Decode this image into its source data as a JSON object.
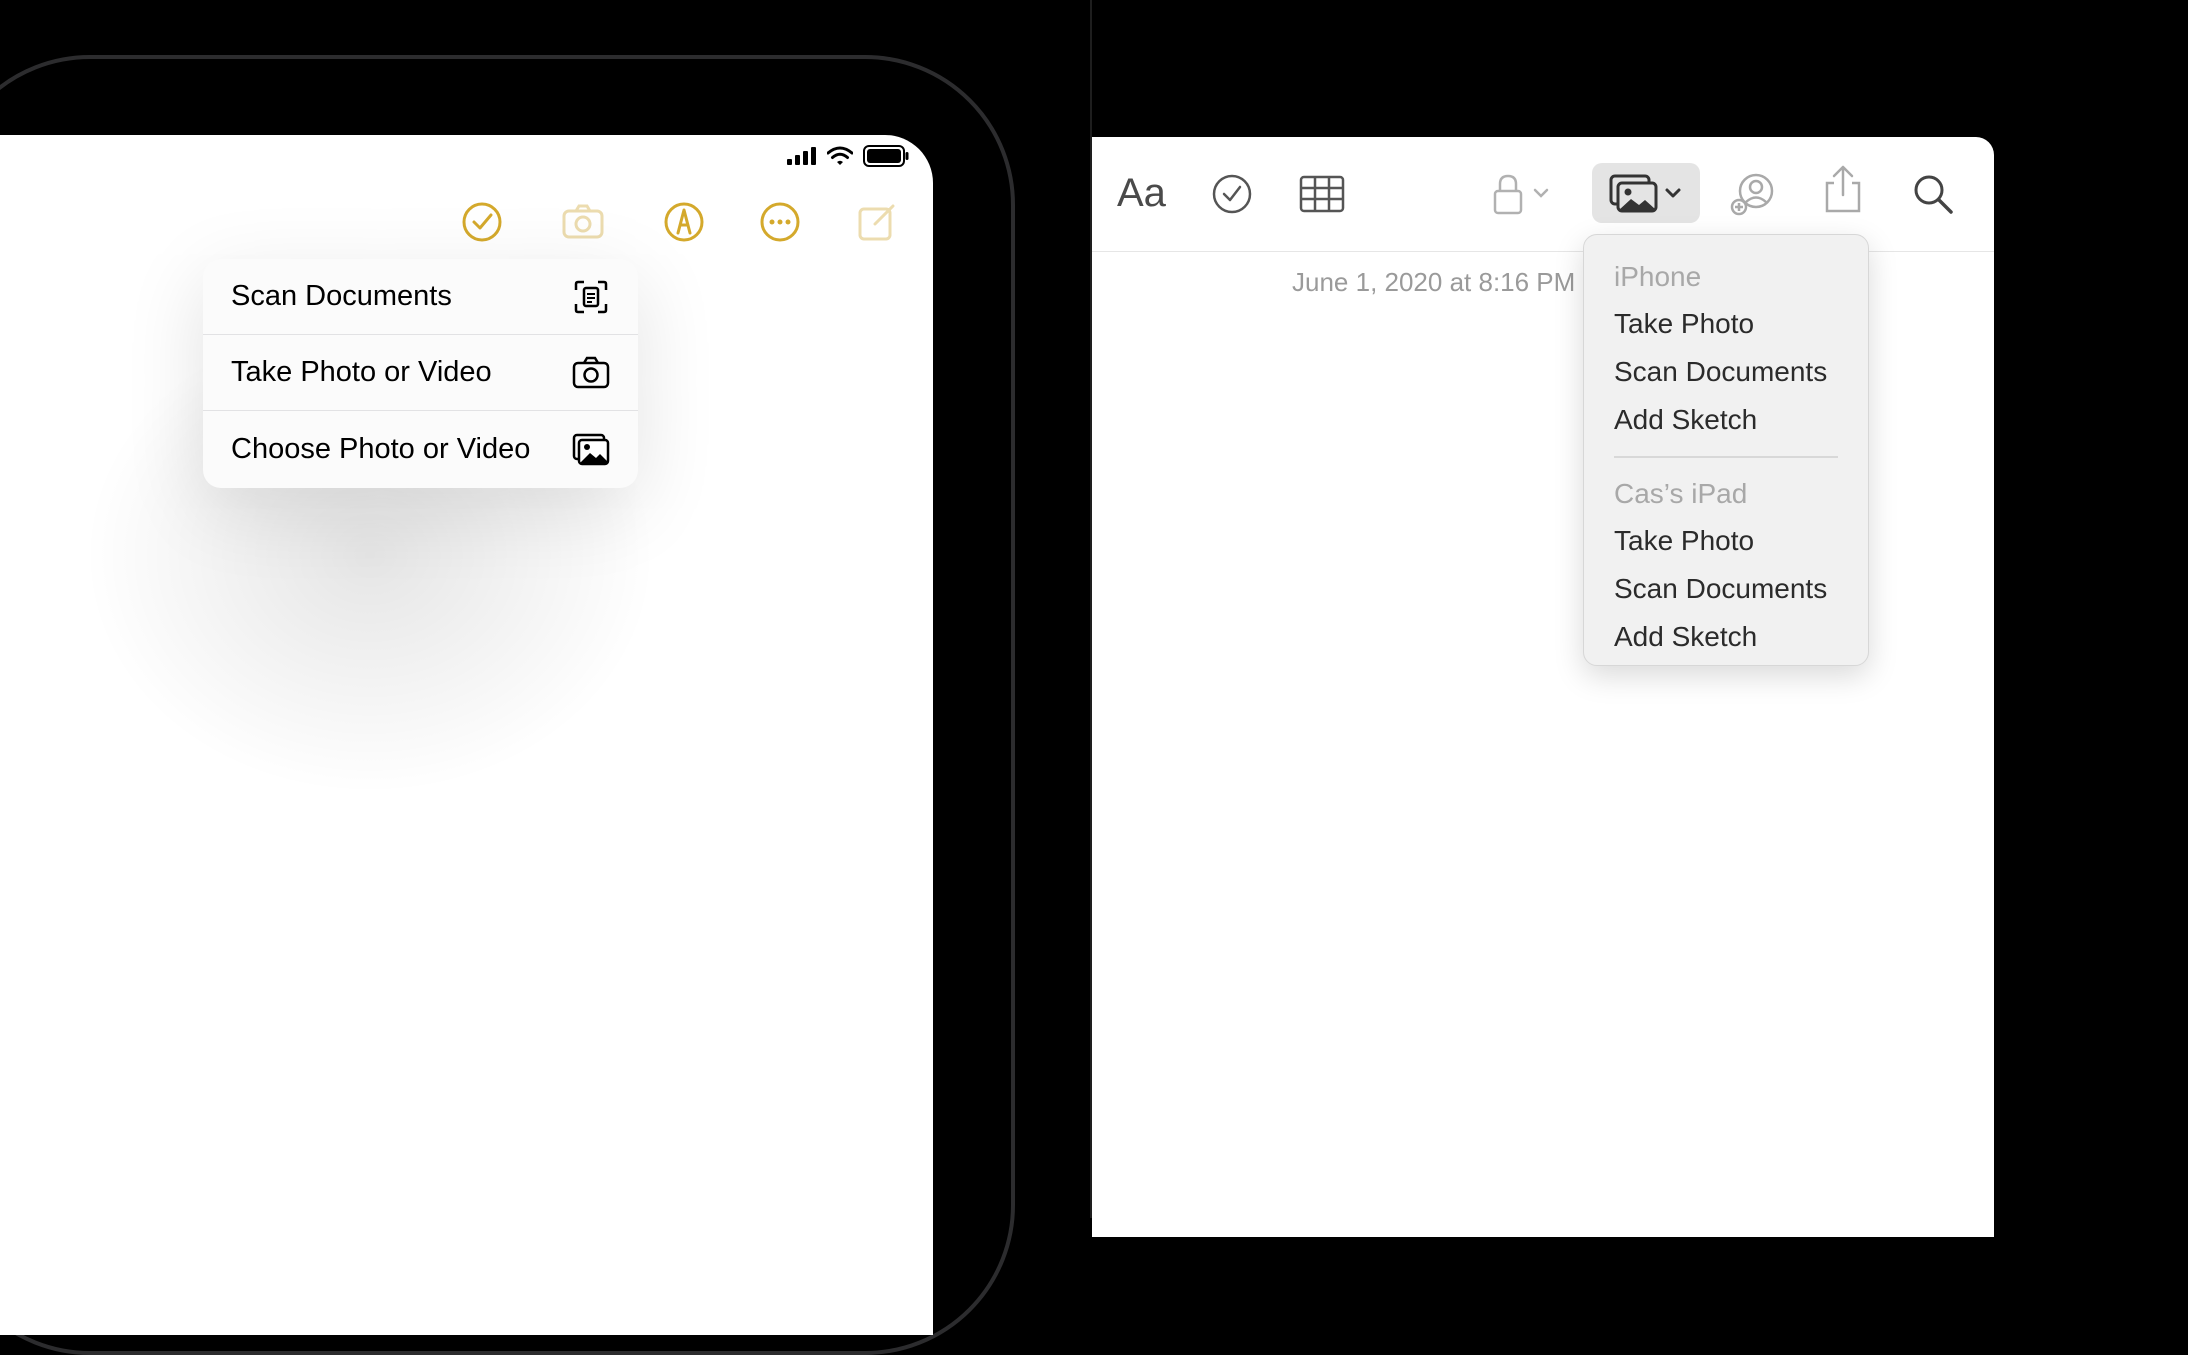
{
  "ipad": {
    "toolbar_icons": [
      "checklist-icon",
      "camera-icon",
      "markup-icon",
      "more-icon",
      "compose-icon"
    ],
    "status_icons": [
      "cellular-signal-icon",
      "wifi-icon",
      "battery-icon"
    ],
    "accent_color": "#D4A92C",
    "menu": {
      "items": [
        {
          "label": "Scan Documents",
          "icon": "scan-documents-icon"
        },
        {
          "label": "Take Photo or Video",
          "icon": "camera-icon"
        },
        {
          "label": "Choose Photo or Video",
          "icon": "photo-library-icon"
        }
      ]
    }
  },
  "mac": {
    "toolbar": {
      "format_label": "Aa",
      "icons": [
        "checklist-icon",
        "table-icon",
        "lock-icon",
        "media-icon",
        "collaborate-icon",
        "share-icon",
        "search-icon"
      ]
    },
    "note_date": "June 1, 2020 at 8:16 PM",
    "media_menu": {
      "sections": [
        {
          "title": "iPhone",
          "items": [
            "Take Photo",
            "Scan Documents",
            "Add Sketch"
          ]
        },
        {
          "title": "Cas’s iPad",
          "items": [
            "Take Photo",
            "Scan Documents",
            "Add Sketch"
          ]
        }
      ]
    }
  }
}
